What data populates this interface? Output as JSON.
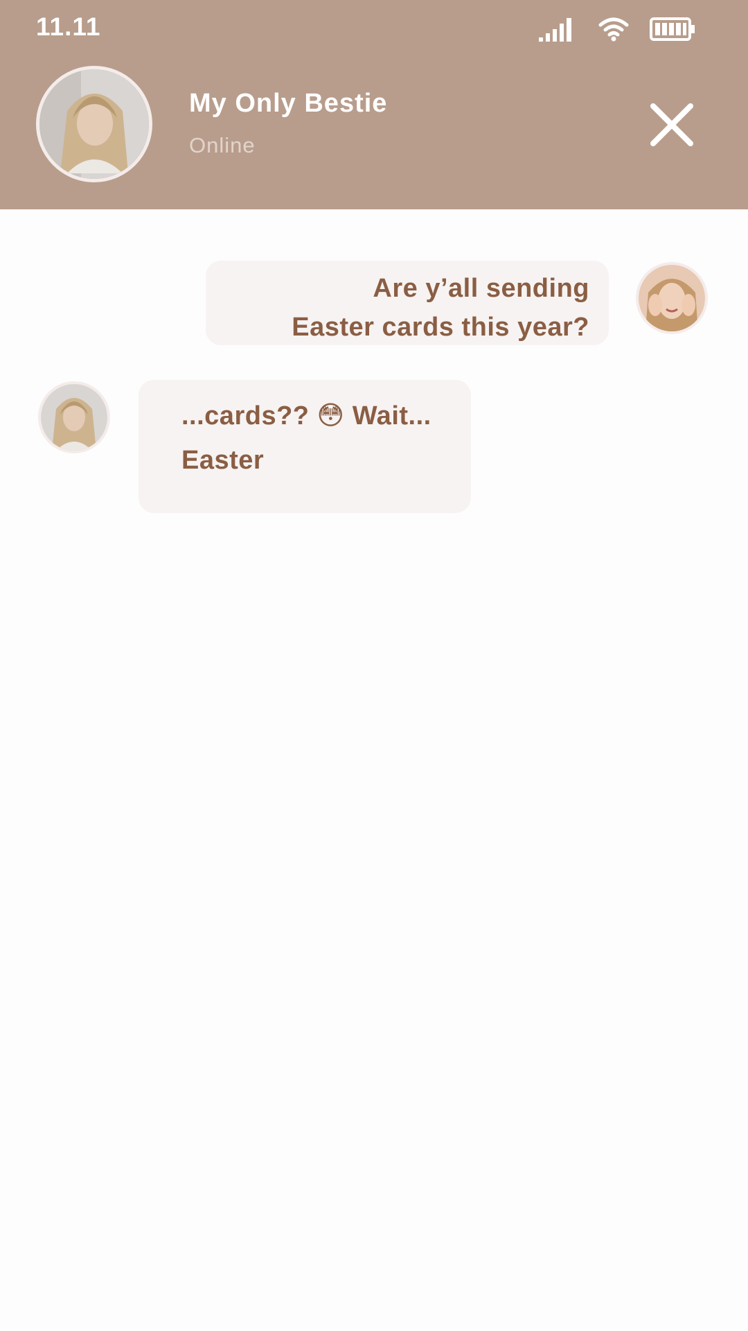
{
  "status_bar": {
    "time": "11.11",
    "icons": [
      "signal-icon",
      "wifi-icon",
      "battery-icon"
    ]
  },
  "header": {
    "contact_name": "My Only Bestie",
    "contact_status": "Online",
    "close_icon": "close-icon",
    "background_color": "#b89d8c"
  },
  "messages": [
    {
      "direction": "outgoing",
      "lines": [
        "Are y’all sending",
        "Easter cards this year?"
      ]
    },
    {
      "direction": "incoming",
      "lines": [
        "...cards?? 😳 Wait...",
        "Easter"
      ]
    }
  ],
  "colors": {
    "bubble": "#f7f3f2",
    "message_text": "#8a5e44",
    "header": "#b89d8c"
  }
}
